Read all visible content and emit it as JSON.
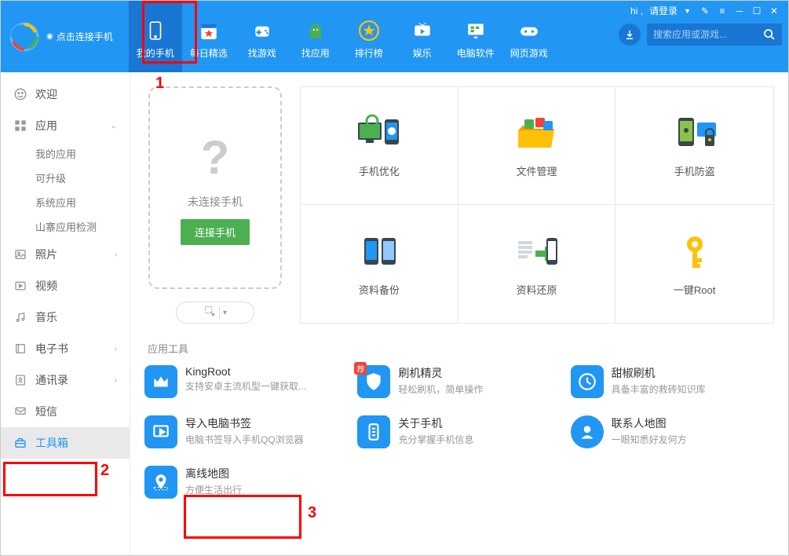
{
  "header": {
    "connect_hint": "点击连接手机",
    "login_prefix": "hi ,",
    "login_text": "请登录",
    "search_placeholder": "搜索应用或游戏...",
    "nav": [
      {
        "label": "我的手机",
        "icon": "phone"
      },
      {
        "label": "每日精选",
        "icon": "calendar"
      },
      {
        "label": "找游戏",
        "icon": "gamepad"
      },
      {
        "label": "找应用",
        "icon": "bag"
      },
      {
        "label": "排行榜",
        "icon": "star"
      },
      {
        "label": "娱乐",
        "icon": "tv"
      },
      {
        "label": "电脑软件",
        "icon": "desktop"
      },
      {
        "label": "网页游戏",
        "icon": "joystick"
      }
    ]
  },
  "sidebar": {
    "items": [
      {
        "label": "欢迎",
        "icon": "smile"
      },
      {
        "label": "应用",
        "icon": "grid",
        "expanded": true,
        "children": [
          "我的应用",
          "可升级",
          "系统应用",
          "山寨应用检测"
        ]
      },
      {
        "label": "照片",
        "icon": "image"
      },
      {
        "label": "视频",
        "icon": "play"
      },
      {
        "label": "音乐",
        "icon": "music"
      },
      {
        "label": "电子书",
        "icon": "book"
      },
      {
        "label": "通讯录",
        "icon": "contacts"
      },
      {
        "label": "短信",
        "icon": "sms"
      },
      {
        "label": "工具箱",
        "icon": "toolbox",
        "active": true
      }
    ]
  },
  "phone_panel": {
    "noconn": "未连接手机",
    "connect_btn": "连接手机"
  },
  "cards": [
    {
      "label": "手机优化"
    },
    {
      "label": "文件管理"
    },
    {
      "label": "手机防盗"
    },
    {
      "label": "资料备份"
    },
    {
      "label": "资料还原"
    },
    {
      "label": "一键Root"
    }
  ],
  "tools": {
    "title": "应用工具",
    "items": [
      {
        "name": "KingRoot",
        "desc": "支持安卓主流机型一键获取...",
        "icon": "crown"
      },
      {
        "name": "刷机精灵",
        "desc": "轻松刷机，简单操作",
        "icon": "shield",
        "badge": "荐"
      },
      {
        "name": "甜椒刷机",
        "desc": "具备丰富的救砖知识库",
        "icon": "pepper"
      },
      {
        "name": "导入电脑书签",
        "desc": "电脑书签导入手机QQ浏览器",
        "icon": "bookmark"
      },
      {
        "name": "关于手机",
        "desc": "充分掌握手机信息",
        "icon": "phoneinfo"
      },
      {
        "name": "联系人地图",
        "desc": "一眼知悉好友何方",
        "icon": "contactmap"
      },
      {
        "name": "离线地图",
        "desc": "方便生活出行",
        "icon": "offlinemap"
      }
    ]
  },
  "annotations": {
    "a1": "1",
    "a2": "2",
    "a3": "3"
  }
}
